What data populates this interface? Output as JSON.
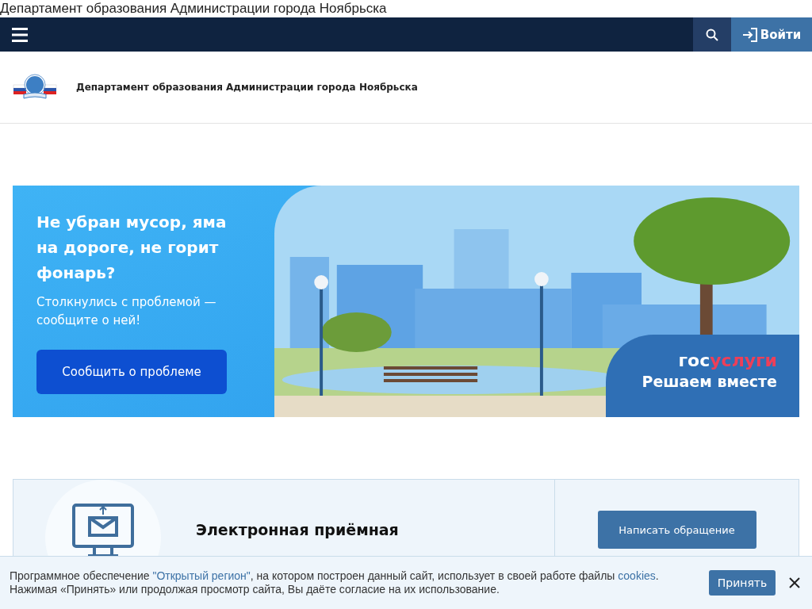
{
  "page_title": "Департамент образования Администрации города Ноябрьска",
  "navbar": {
    "login": "Войти"
  },
  "header": {
    "title": "Департамент образования Администрации города Ноябрьска"
  },
  "banner": {
    "heading": "Не убран мусор, яма на дороге, не горит фонарь?",
    "text": "Столкнулись с проблемой — сообщите о ней!",
    "button": "Сообщить о проблеме",
    "logo_prefix": "гос",
    "logo_suffix": "услуги",
    "slogan": "Решаем вместе"
  },
  "reception": {
    "title": "Электронная приёмная",
    "button": "Написать обращение"
  },
  "cookie": {
    "lines": [
      [
        {
          "kind": "plain",
          "text": "Программное обеспечение "
        },
        {
          "kind": "link",
          "text": "\"Открытый регион\""
        },
        {
          "kind": "plain",
          "text": ", на котором построен данный сайт, использует в своей работе файлы "
        },
        {
          "kind": "link",
          "text": "cookies"
        },
        {
          "kind": "plain",
          "text": "."
        }
      ],
      [
        {
          "kind": "plain",
          "text": "Нажимая «Принять» или продолжая просмотр сайта, Вы даёте согласие на их использование."
        }
      ]
    ],
    "accept": "Принять"
  }
}
